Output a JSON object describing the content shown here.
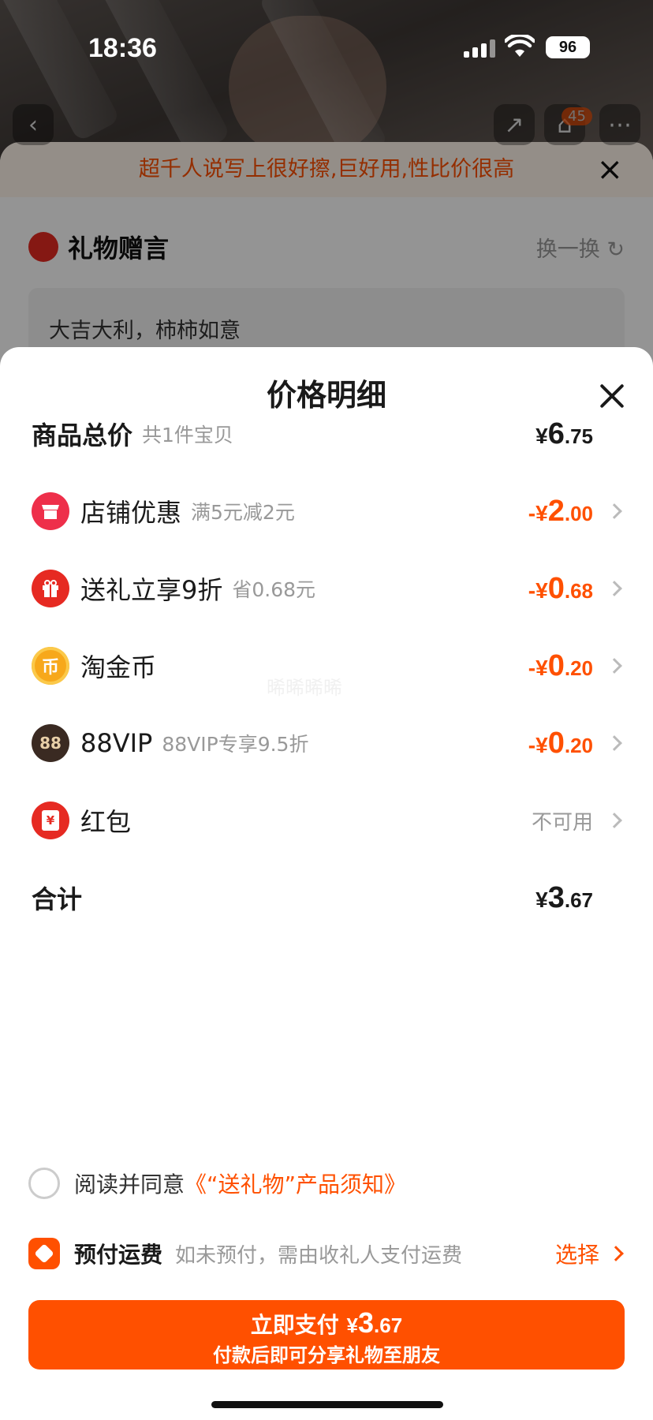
{
  "status": {
    "time": "18:36",
    "battery": "96"
  },
  "background": {
    "cart_count": "45",
    "banner": "超千人说写上很好擦,巨好用,性比价很高",
    "gift_title": "礼物赠言",
    "swap_label": "换一换",
    "gift_message": "大吉大利，柿柿如意"
  },
  "sheet": {
    "title": "价格明细",
    "rows": [
      {
        "label": "商品总价",
        "sub": "共1件宝贝",
        "amount": {
          "cur": "¥",
          "int": "6",
          "dec": ".75"
        }
      },
      {
        "label": "店铺优惠",
        "sub": "满5元减2元",
        "amount": {
          "cur": "-¥",
          "int": "2",
          "dec": ".00"
        },
        "icon": "store-icon",
        "color": "#ee2f4a"
      },
      {
        "label": "送礼立享9折",
        "sub": "省0.68元",
        "amount": {
          "cur": "-¥",
          "int": "0",
          "dec": ".68"
        },
        "icon": "gift-icon",
        "color": "#e62a22"
      },
      {
        "label": "淘金币",
        "sub": "",
        "amount": {
          "cur": "-¥",
          "int": "0",
          "dec": ".20"
        },
        "icon": "coin-icon",
        "glyph": "币",
        "color": "#f7a81b"
      },
      {
        "label": "88VIP",
        "sub": "88VIP专享9.5折",
        "amount": {
          "cur": "-¥",
          "int": "0",
          "dec": ".20"
        },
        "icon": "vip-icon",
        "glyph": "88",
        "color": "#3a2a22"
      },
      {
        "label": "红包",
        "sub": "",
        "status": "不可用",
        "icon": "red-packet-icon",
        "glyph": "¥",
        "color": "#e62a22"
      },
      {
        "label": "合计",
        "sub": "",
        "amount": {
          "cur": "¥",
          "int": "3",
          "dec": ".67"
        }
      }
    ],
    "watermark": "晞晞晞晞"
  },
  "agree": {
    "text": "阅读并同意",
    "link": "《“送礼物”产品须知》"
  },
  "prepay": {
    "title": "预付运费",
    "desc": "如未预付，需由收礼人支付运费",
    "action": "选择"
  },
  "pay": {
    "label": "立即支付",
    "cur": "¥",
    "int": "3",
    "dec": ".67",
    "sub": "付款后即可分享礼物至朋友"
  },
  "colors": {
    "accent": "#ff5000",
    "text": "#1a1a1a",
    "muted": "#999999"
  }
}
